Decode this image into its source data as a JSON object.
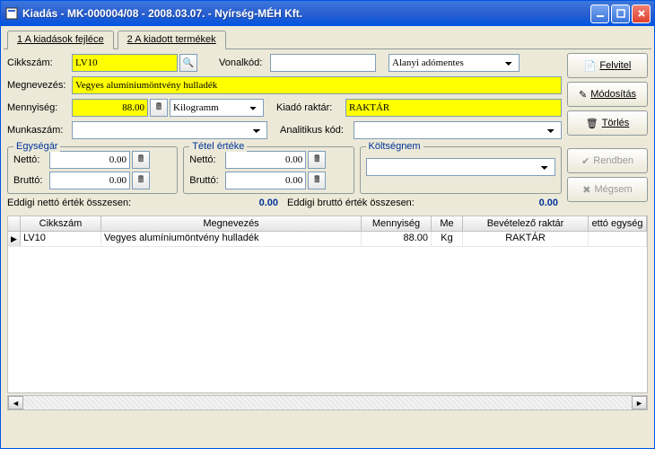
{
  "title": "Kiadás  -  MK-000004/08  -  2008.03.07.  -  Nyírség-MÉH Kft.",
  "tabs": [
    {
      "label": "1  A kiadások fejléce"
    },
    {
      "label": "2  A kiadott termékek"
    }
  ],
  "labels": {
    "cikkszam": "Cikkszám:",
    "vonalkod": "Vonalkód:",
    "megnevezes": "Megnevezés:",
    "mennyiseg": "Mennyiség:",
    "kiado_raktar": "Kiadó raktár:",
    "munkaszam": "Munkaszám:",
    "analitikus": "Analitikus kód:",
    "egysegar": "Egységár",
    "tetel_erteke": "Tétel értéke",
    "koltsegnem": "Költségnem",
    "netto": "Nettó:",
    "brutto": "Bruttó:",
    "eddigi_netto": "Eddigi nettó érték összesen:",
    "eddigi_brutto": "Eddigi bruttó érték összesen:"
  },
  "values": {
    "cikkszam": "LV10",
    "vonalkod": "",
    "afa": "Alanyi adómentes",
    "megnevezes": "Vegyes alumíniumöntvény hulladék",
    "mennyiseg": "88.00",
    "mertekegyseg": "Kilogramm",
    "kiado_raktar": "RAKTÁR",
    "munkaszam": "",
    "analitikus": "",
    "egysegar_netto": "0.00",
    "egysegar_brutto": "0.00",
    "tetel_netto": "0.00",
    "tetel_brutto": "0.00",
    "koltsegnem": "",
    "eddigi_netto": "0.00",
    "eddigi_brutto": "0.00"
  },
  "buttons": {
    "felvitel": "Felvitel",
    "modositas": "Módosítás",
    "torles": "Törlés",
    "rendben": "Rendben",
    "megsem": "Mégsem"
  },
  "grid": {
    "headers": [
      "Cikkszám",
      "Megnevezés",
      "Mennyiség",
      "Me",
      "Bevételező raktár",
      "ettó egység"
    ],
    "rows": [
      {
        "cikkszam": "LV10",
        "megnev": "Vegyes alumíniumöntvény hulladék",
        "menny": "88.00",
        "me": "Kg",
        "raktar": "RAKTÁR",
        "egys": ""
      }
    ]
  }
}
